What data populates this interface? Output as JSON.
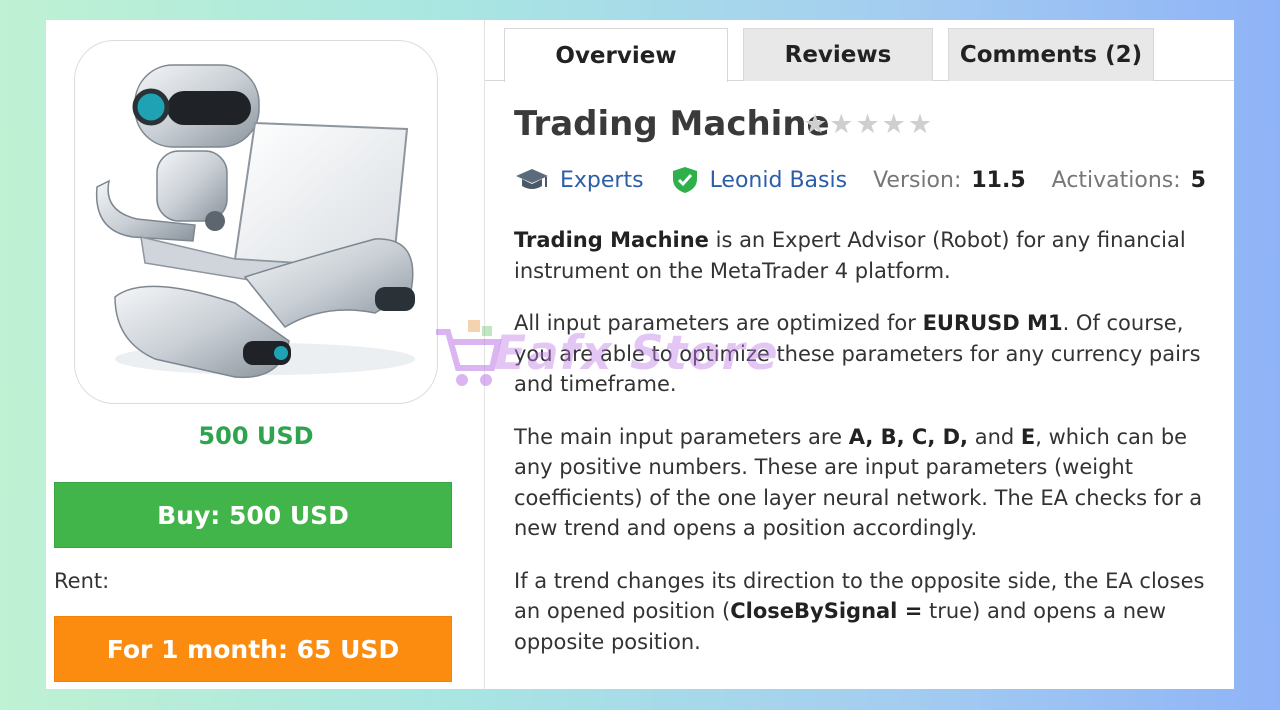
{
  "product": {
    "title": "Trading Machine",
    "rating_stars": 5,
    "rating_filled": 0,
    "price": "500 USD",
    "buy_label": "Buy: 500 USD",
    "rent_label": "Rent:",
    "rent_option": "For 1 month: 65 USD"
  },
  "tabs": [
    {
      "label": "Overview",
      "active": true
    },
    {
      "label": "Reviews",
      "active": false
    },
    {
      "label": "Comments (2)",
      "active": false
    }
  ],
  "meta": {
    "category": "Experts",
    "author": "Leonid Basis",
    "version_label": "Version:",
    "version_value": "11.5",
    "activations_label": "Activations:",
    "activations_value": "5"
  },
  "description": {
    "p1_bold": "Trading Machine",
    "p1_rest": " is an Expert Advisor (Robot) for any financial instrument on the MetaTrader 4 platform.",
    "p2_a": "All input parameters are optimized for ",
    "p2_bold": "EURUSD M1",
    "p2_b": ". Of course, you are able to optimize these parameters for any currency pairs and timeframe.",
    "p3_a": "The main input parameters are ",
    "p3_bold": "A, B, C, D,",
    "p3_mid": " and ",
    "p3_bold2": "E",
    "p3_b": ", which can be any positive numbers. These are input parameters (weight coefficients) of the one layer neural network. The EA checks for a new trend and opens a position accordingly.",
    "p4_a": "If a trend changes its direction to the opposite side, the EA closes an opened position (",
    "p4_bold": "CloseBySignal =",
    "p4_b": " true) and opens a new opposite position."
  },
  "watermark": {
    "text": "Eafx Store"
  },
  "colors": {
    "price_green": "#2ea44f",
    "buy_green": "#41b549",
    "rent_orange": "#fb8c0f",
    "link_blue": "#2d5ea8",
    "verified_green": "#2eb04a"
  },
  "icons": {
    "category": "graduation-cap-icon",
    "author": "verified-shield-icon",
    "rating": "star-icon",
    "watermark": "shopping-cart-icon"
  }
}
